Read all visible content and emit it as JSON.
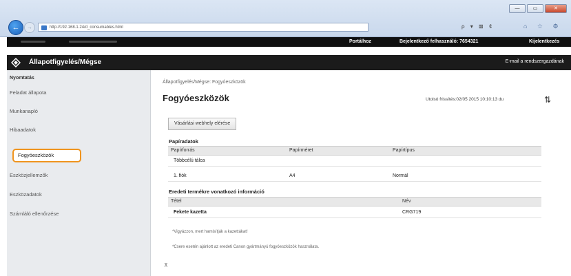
{
  "browser": {
    "url": "http://192.168.1.24/d_consumables.html",
    "window_controls": [
      "—",
      "▭",
      "✕"
    ],
    "addr_tools": "ρ ▾ ⊠ ¢",
    "home_icons": "⌂ ☆ ⚙"
  },
  "topbar": {
    "portal": "Portálhoz",
    "login": "Bejelentkező felhasználó:  7654321",
    "logout": "Kijelentkezés"
  },
  "titlebar": {
    "title": "Állapotfigyelés/Mégse",
    "email": "E-mail a rendszergazdának"
  },
  "sidebar": {
    "header": "Nyomtatás",
    "items": [
      "Feladat állapota",
      "Munkanapló",
      "Hibaadatok",
      "Fogyóeszközök",
      "Eszközjellemzők",
      "Eszközadatok",
      "Számláló ellenőrzése"
    ]
  },
  "main": {
    "breadcrumb": "Állapotfigyelés/Mégse: Fogyóeszközök",
    "title": "Fogyóeszközök",
    "update": "Utolsó frissítés:02/05 2015 10:10:13 du",
    "buy_button": "Vásárlási webhely elérése",
    "paper_section": "Papíradatok",
    "paper_headers": [
      "Papírforrás",
      "Papírméret",
      "Papírtípus"
    ],
    "paper_rows": [
      [
        "Többcélú tálca",
        "",
        ""
      ],
      [
        "1. fiók",
        "A4",
        "Normál"
      ]
    ],
    "genuine_section": "Eredeti termékre vonatkozó információ",
    "genuine_headers": [
      "Tétel",
      "Név"
    ],
    "genuine_rows": [
      [
        "Fekete kazetta",
        "CRG719"
      ]
    ],
    "note1": "*Vigyázzon, mert hamisítják a kazettákat!",
    "note2": "*Csere esetén ajánlott az eredeti Canon gyártmányú fogyóeszközök használata.",
    "to_top": "⊼"
  }
}
